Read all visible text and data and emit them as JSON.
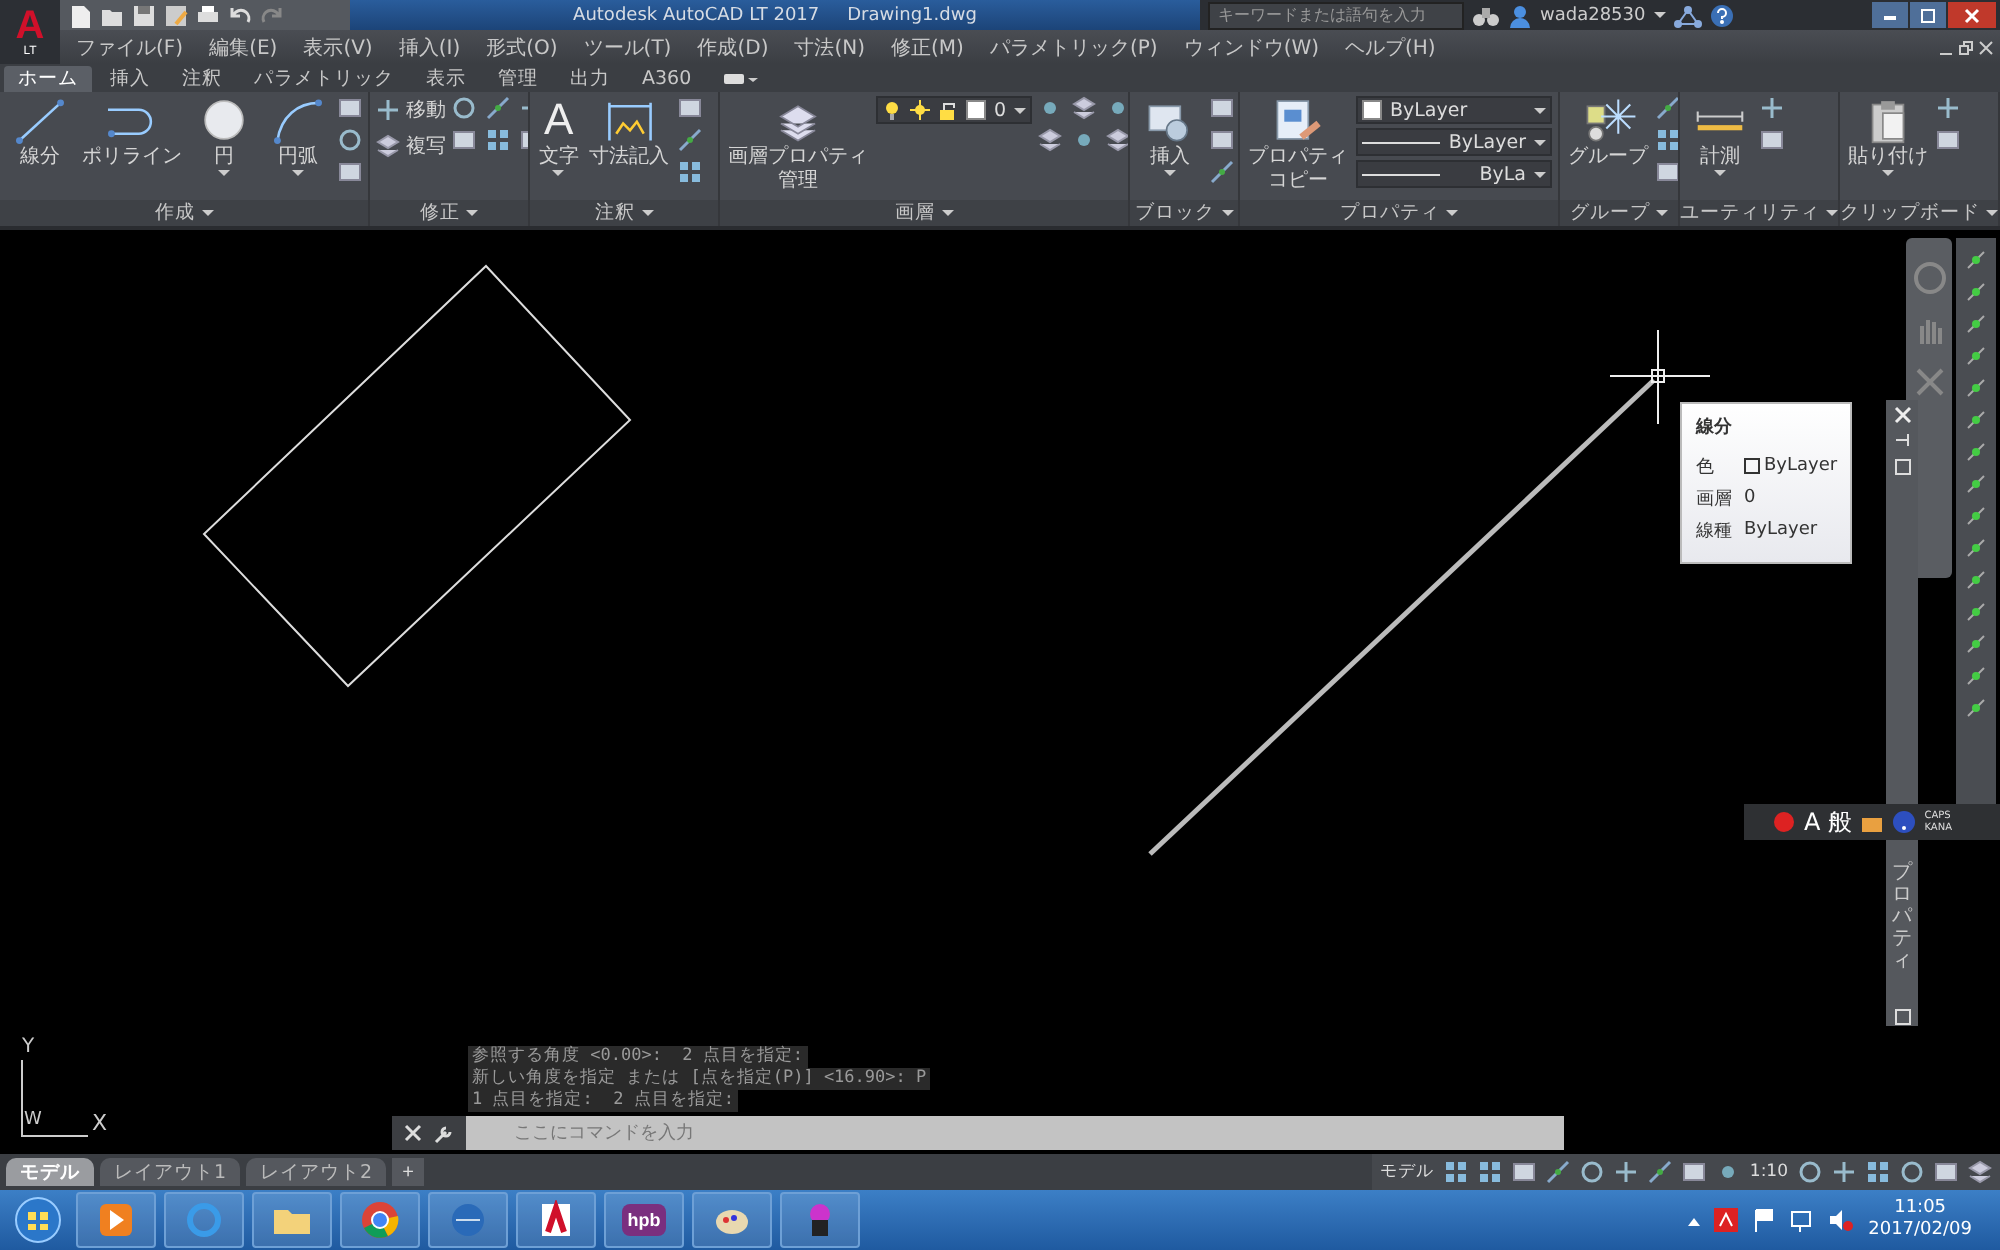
{
  "window": {
    "title": "Autodesk AutoCAD LT 2017",
    "document": "Drawing1.dwg"
  },
  "app_menu": {
    "logo": "A",
    "edition": "LT"
  },
  "search": {
    "placeholder": "キーワードまたは語句を入力"
  },
  "user": {
    "name": "wada28530"
  },
  "menu": [
    "ファイル(F)",
    "編集(E)",
    "表示(V)",
    "挿入(I)",
    "形式(O)",
    "ツール(T)",
    "作成(D)",
    "寸法(N)",
    "修正(M)",
    "パラメトリック(P)",
    "ウィンドウ(W)",
    "ヘルプ(H)"
  ],
  "ribbon_tabs": [
    {
      "label": "ホーム",
      "selected": true
    },
    {
      "label": "挿入",
      "selected": false
    },
    {
      "label": "注釈",
      "selected": false
    },
    {
      "label": "パラメトリック",
      "selected": false
    },
    {
      "label": "表示",
      "selected": false
    },
    {
      "label": "管理",
      "selected": false
    },
    {
      "label": "出力",
      "selected": false
    },
    {
      "label": "A360",
      "selected": false
    }
  ],
  "panels": [
    {
      "title": "作成",
      "items": [
        {
          "kind": "large",
          "label": "線分",
          "dropdown": false
        },
        {
          "kind": "large",
          "label": "ポリライン",
          "dropdown": false
        },
        {
          "kind": "large",
          "label": "円",
          "dropdown": true
        },
        {
          "kind": "large",
          "label": "円弧",
          "dropdown": true
        }
      ]
    },
    {
      "title": "修正",
      "items": [
        {
          "kind": "small",
          "label": "移動"
        },
        {
          "kind": "small",
          "label": "複写"
        }
      ]
    },
    {
      "title": "注釈",
      "items": [
        {
          "kind": "large",
          "label": "文字",
          "glyph": "A",
          "dropdown": true
        },
        {
          "kind": "large",
          "label": "寸法記入",
          "dropdown": false
        }
      ]
    },
    {
      "title": "画層",
      "items": [
        {
          "kind": "large",
          "label": [
            "画層プロパティ",
            "管理"
          ],
          "dropdown": false
        },
        {
          "kind": "layer_dropdown",
          "value": "0"
        }
      ]
    },
    {
      "title": "ブロック",
      "items": [
        {
          "kind": "large",
          "label": "挿入",
          "dropdown": true
        }
      ]
    },
    {
      "title": "プロパティ",
      "items": [
        {
          "kind": "large",
          "label": [
            "プロパティ",
            "コピー"
          ],
          "dropdown": false
        },
        {
          "kind": "color_dropdown",
          "value": "ByLayer"
        },
        {
          "kind": "line_dropdown",
          "value": "ByLayer"
        },
        {
          "kind": "line_dropdown",
          "value": "ByLa"
        }
      ]
    },
    {
      "title": "グループ",
      "items": [
        {
          "kind": "large",
          "label": "グループ",
          "dropdown": false
        }
      ]
    },
    {
      "title": "ユーティリティ",
      "items": [
        {
          "kind": "large",
          "label": "計測",
          "dropdown": true
        }
      ]
    },
    {
      "title": "クリップボード",
      "items": [
        {
          "kind": "large",
          "label": "貼り付け",
          "dropdown": true
        }
      ]
    }
  ],
  "tooltip": {
    "title": "線分",
    "rows": [
      {
        "label": "色",
        "value": "ByLayer",
        "swatch": true
      },
      {
        "label": "画層",
        "value": "0",
        "swatch": false
      },
      {
        "label": "線種",
        "value": "ByLayer",
        "swatch": false
      }
    ]
  },
  "properties_palette": {
    "title": "プロパティ"
  },
  "ime_bar": {
    "mode": "A",
    "input": "般",
    "caps": "CAPS",
    "kana": "KANA"
  },
  "command_history": [
    "参照する角度 <0.00>:  2 点目を指定:",
    "新しい角度を指定 または [点を指定(P)] <16.90>: P",
    "1 点目を指定:  2 点目を指定:"
  ],
  "command_line": {
    "placeholder": "ここにコマンドを入力"
  },
  "ucs": {
    "y": "Y",
    "w": "W",
    "x": "X"
  },
  "layout_tabs": [
    {
      "label": "モデル",
      "selected": true
    },
    {
      "label": "レイアウト1",
      "selected": false
    },
    {
      "label": "レイアウト2",
      "selected": false
    }
  ],
  "add_tab": "+",
  "status_bar": {
    "space": "モデル",
    "scale": "1:10"
  },
  "taskbar": {
    "apps": [
      {
        "kind": "player"
      },
      {
        "kind": "browser"
      },
      {
        "kind": "folder"
      },
      {
        "kind": "chrome"
      },
      {
        "kind": "mail"
      },
      {
        "kind": "cad"
      },
      {
        "kind": "hpb",
        "label": "hpb"
      },
      {
        "kind": "paint"
      },
      {
        "kind": "figure"
      }
    ],
    "time": "11:05",
    "date": "2017/02/09"
  }
}
